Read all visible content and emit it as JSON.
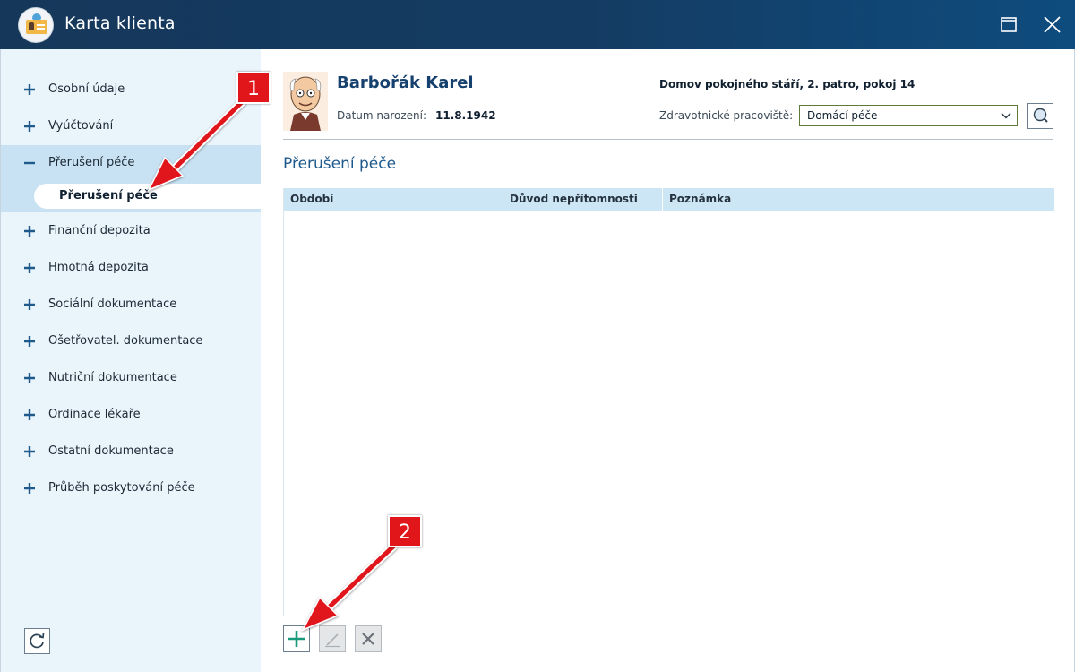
{
  "window": {
    "title": "Karta klienta"
  },
  "sidebar": {
    "items": [
      {
        "label": "Osobní údaje",
        "sign": "+"
      },
      {
        "label": "Vyúčtování",
        "sign": "+"
      },
      {
        "label": "Přerušení péče",
        "sign": "−"
      },
      {
        "label": "Finanční depozita",
        "sign": "+"
      },
      {
        "label": "Hmotná depozita",
        "sign": "+"
      },
      {
        "label": "Sociální dokumentace",
        "sign": "+"
      },
      {
        "label": "Ošetřovatel. dokumentace",
        "sign": "+"
      },
      {
        "label": "Nutriční dokumentace",
        "sign": "+"
      },
      {
        "label": "Ordinace lékaře",
        "sign": "+"
      },
      {
        "label": "Ostatní dokumentace",
        "sign": "+"
      },
      {
        "label": "Průběh poskytování péče",
        "sign": "+"
      }
    ],
    "active_subitem": "Přerušení péče"
  },
  "client": {
    "name": "Barbořák Karel",
    "dob_label": "Datum narození:",
    "dob_value": "11.8.1942",
    "address": "Domov pokojného stáří, 2. patro, pokoj 14",
    "workstation_label": "Zdravotnické pracoviště:",
    "workstation_value": "Domácí péče"
  },
  "section": {
    "title": "Přerušení péče",
    "columns": [
      "Období",
      "Důvod nepřítomnosti",
      "Poznámka"
    ]
  },
  "annotations": {
    "callout_1": "1",
    "callout_2": "2",
    "color": "#e0161b"
  },
  "icons": {
    "app": "client-card-icon",
    "maximize": "maximize-icon",
    "close": "close-icon",
    "refresh": "refresh-icon",
    "search": "search-icon",
    "add": "plus-icon",
    "edit": "pencil-icon",
    "delete": "x-icon"
  },
  "colors": {
    "titlebar": "#15375a",
    "sidebar": "#eaf4fb",
    "active": "#c8e2f3",
    "accent": "#16406e",
    "add_icon": "#1a9a7c"
  }
}
